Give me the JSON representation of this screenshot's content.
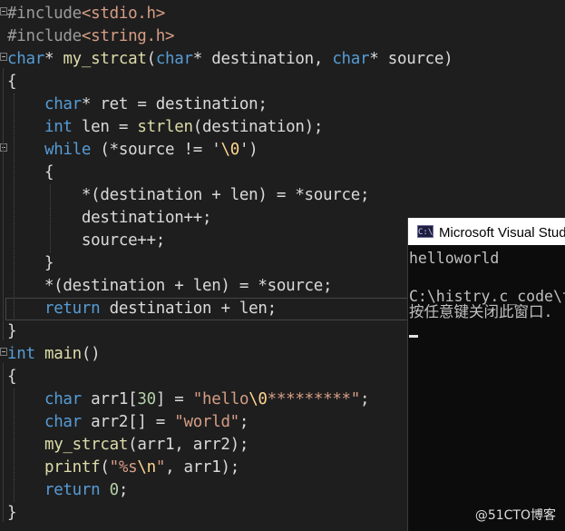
{
  "editor": {
    "lines": [
      {
        "parts": [
          [
            "pre",
            "#include"
          ],
          [
            "inc",
            "<stdio.h>"
          ]
        ]
      },
      {
        "parts": [
          [
            "pre",
            "#include"
          ],
          [
            "inc",
            "<string.h>"
          ]
        ]
      },
      {
        "parts": [
          [
            "kw",
            "char"
          ],
          [
            "id",
            "* "
          ],
          [
            "fn",
            "my_strcat"
          ],
          [
            "id",
            "("
          ],
          [
            "kw",
            "char"
          ],
          [
            "id",
            "* destination, "
          ],
          [
            "kw",
            "char"
          ],
          [
            "id",
            "* source)"
          ]
        ]
      },
      {
        "parts": [
          [
            "id",
            "{"
          ]
        ]
      },
      {
        "parts": [
          [
            "id",
            "    "
          ],
          [
            "kw",
            "char"
          ],
          [
            "id",
            "* ret = destination;"
          ]
        ]
      },
      {
        "parts": [
          [
            "id",
            "    "
          ],
          [
            "kw",
            "int"
          ],
          [
            "id",
            " len = "
          ],
          [
            "fn",
            "strlen"
          ],
          [
            "id",
            "(destination);"
          ]
        ]
      },
      {
        "parts": [
          [
            "id",
            "    "
          ],
          [
            "kw",
            "while"
          ],
          [
            "id",
            " (*source != '"
          ],
          [
            "esc",
            "\\0"
          ],
          [
            "id",
            "')"
          ]
        ]
      },
      {
        "parts": [
          [
            "id",
            "    {"
          ]
        ]
      },
      {
        "parts": [
          [
            "id",
            "        *(destination + len) = *source;"
          ]
        ]
      },
      {
        "parts": [
          [
            "id",
            "        destination++;"
          ]
        ]
      },
      {
        "parts": [
          [
            "id",
            "        source++;"
          ]
        ]
      },
      {
        "parts": [
          [
            "id",
            "    }"
          ]
        ]
      },
      {
        "parts": [
          [
            "id",
            "    *(destination + len) = *source;"
          ]
        ]
      },
      {
        "parts": [
          [
            "id",
            "    "
          ],
          [
            "kw",
            "return"
          ],
          [
            "id",
            " destination + len;"
          ]
        ]
      },
      {
        "parts": [
          [
            "id",
            "}"
          ]
        ]
      },
      {
        "parts": [
          [
            "kw",
            "int"
          ],
          [
            "id",
            " "
          ],
          [
            "fn",
            "main"
          ],
          [
            "id",
            "()"
          ]
        ]
      },
      {
        "parts": [
          [
            "id",
            "{"
          ]
        ]
      },
      {
        "parts": [
          [
            "id",
            "    "
          ],
          [
            "kw",
            "char"
          ],
          [
            "id",
            " arr1["
          ],
          [
            "num",
            "30"
          ],
          [
            "id",
            "] = "
          ],
          [
            "str",
            "\"hello"
          ],
          [
            "esc",
            "\\0"
          ],
          [
            "str",
            "*********\""
          ],
          [
            "id",
            ";"
          ]
        ]
      },
      {
        "parts": [
          [
            "id",
            "    "
          ],
          [
            "kw",
            "char"
          ],
          [
            "id",
            " arr2[] = "
          ],
          [
            "str",
            "\"world\""
          ],
          [
            "id",
            ";"
          ]
        ]
      },
      {
        "parts": [
          [
            "id",
            "    "
          ],
          [
            "fn",
            "my_strcat"
          ],
          [
            "id",
            "(arr1, arr2);"
          ]
        ]
      },
      {
        "parts": [
          [
            "id",
            "    "
          ],
          [
            "fn",
            "printf"
          ],
          [
            "id",
            "("
          ],
          [
            "str",
            "\"%s"
          ],
          [
            "esc",
            "\\n"
          ],
          [
            "str",
            "\""
          ],
          [
            "id",
            ", arr1);"
          ]
        ]
      },
      {
        "parts": [
          [
            "id",
            "    "
          ],
          [
            "kw",
            "return"
          ],
          [
            "id",
            " "
          ],
          [
            "num",
            "0"
          ],
          [
            "id",
            ";"
          ]
        ]
      },
      {
        "parts": [
          [
            "id",
            "}"
          ]
        ]
      }
    ]
  },
  "console": {
    "title": "Microsoft Visual Studio 调试控制台",
    "icon_text": "C:\\",
    "lines": [
      "helloworld",
      "",
      "C:\\histry.c_code\\test\\Debug\\test.exe",
      "按任意键关闭此窗口. . ."
    ]
  },
  "watermark": "@51CTO博客"
}
